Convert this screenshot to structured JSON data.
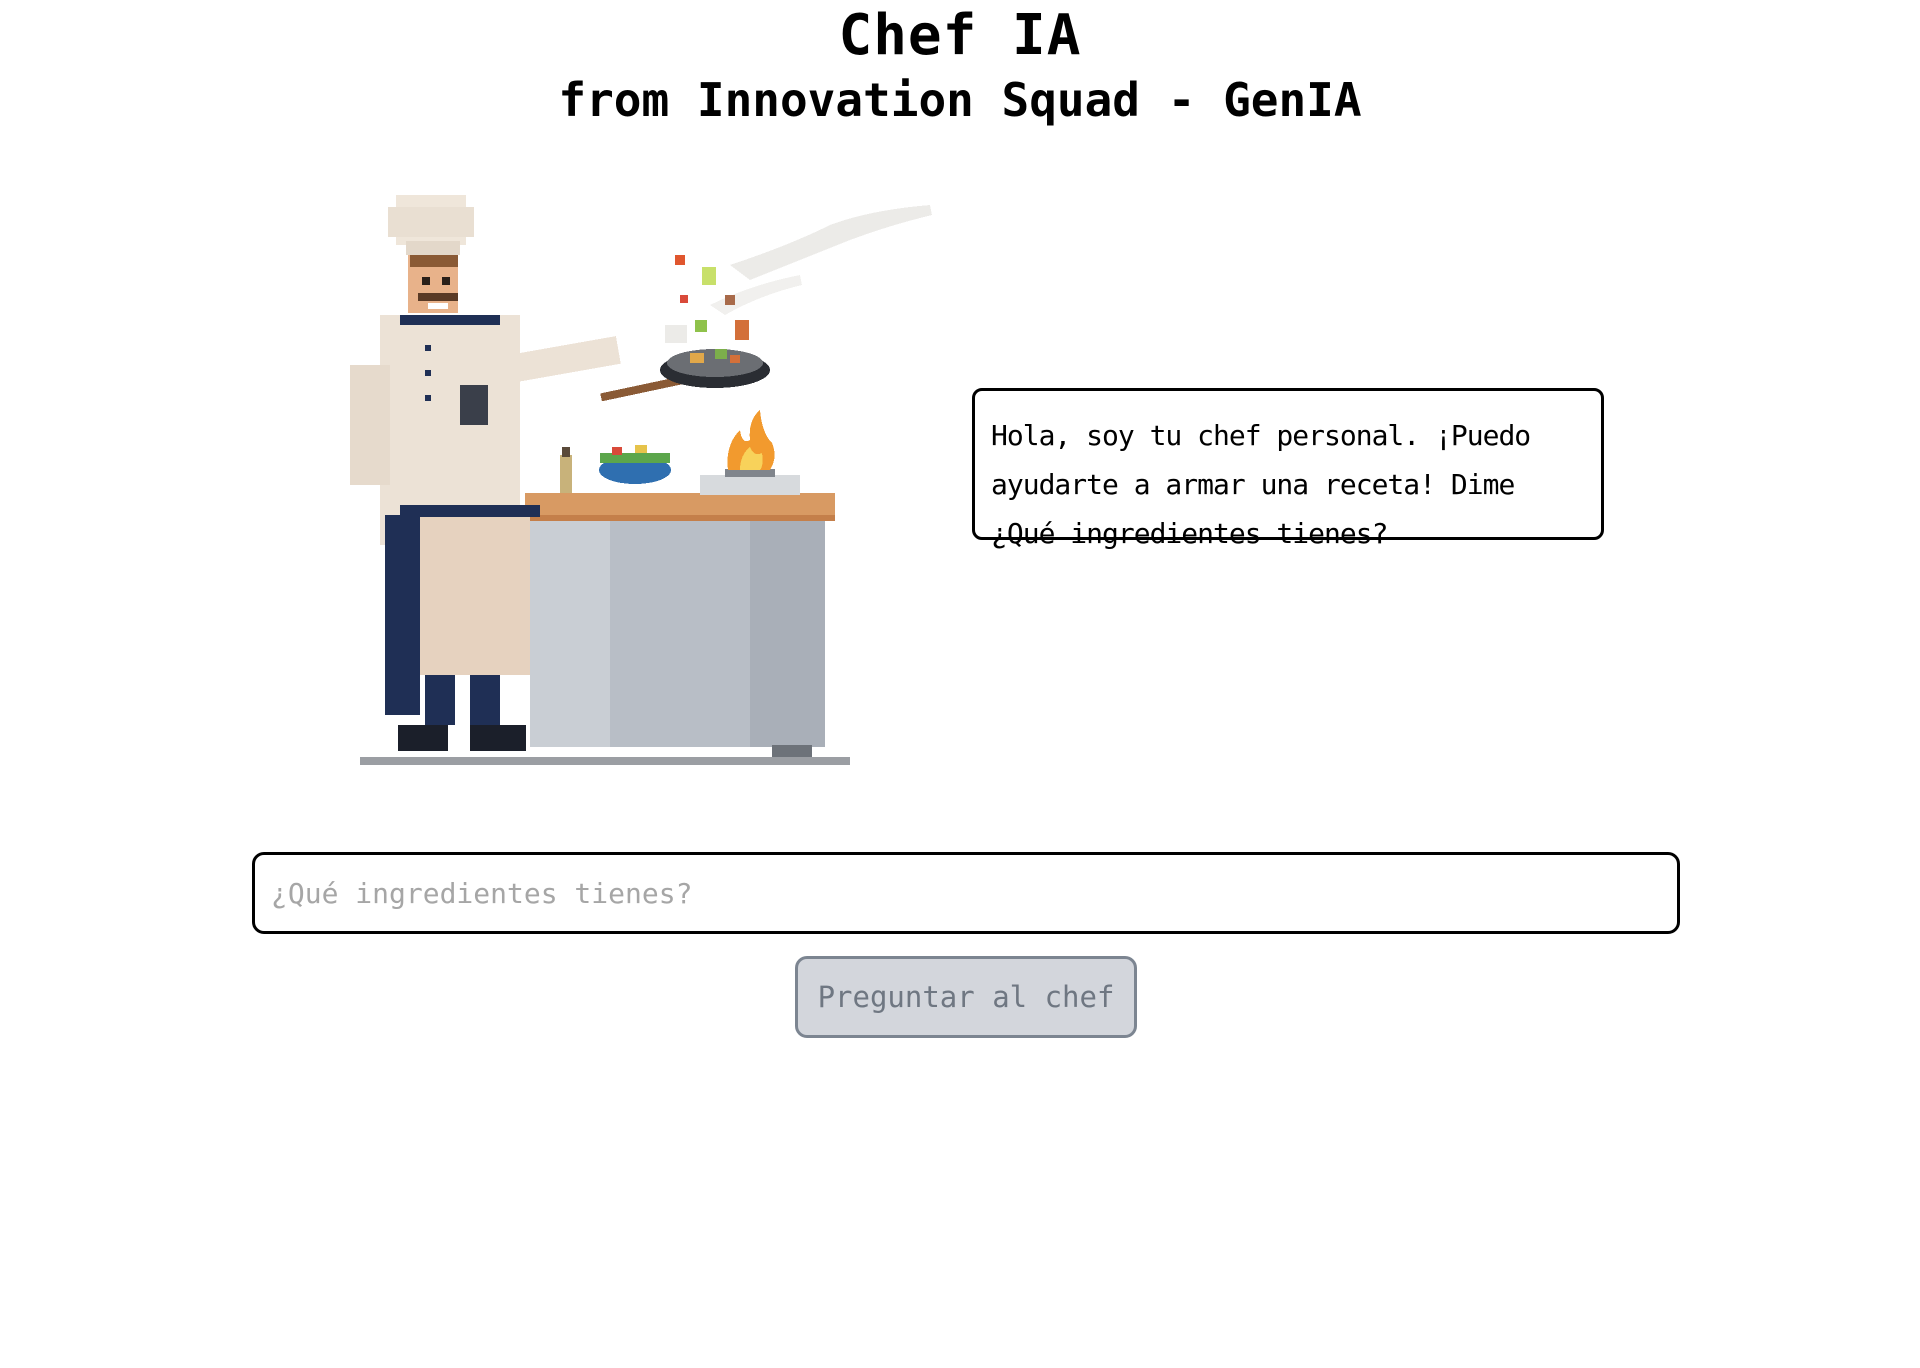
{
  "header": {
    "title": "Chef IA",
    "subtitle": "from Innovation Squad - GenIA"
  },
  "chat": {
    "chef_message": "Hola, soy tu chef personal. ¡Puedo ayudarte a armar una receta! Dime ¿Qué ingredientes tienes?"
  },
  "form": {
    "input_placeholder": "¿Qué ingredientes tienes?",
    "input_value": "",
    "submit_label": "Preguntar al chef",
    "submit_disabled": true
  },
  "illustration": {
    "name": "pixel-chef-cooking",
    "colors": {
      "coat": "#ece2d6",
      "trim": "#1f2f55",
      "counter_top": "#d89a63",
      "counter_body": "#b8bec6",
      "flame": "#f29a2e"
    }
  }
}
